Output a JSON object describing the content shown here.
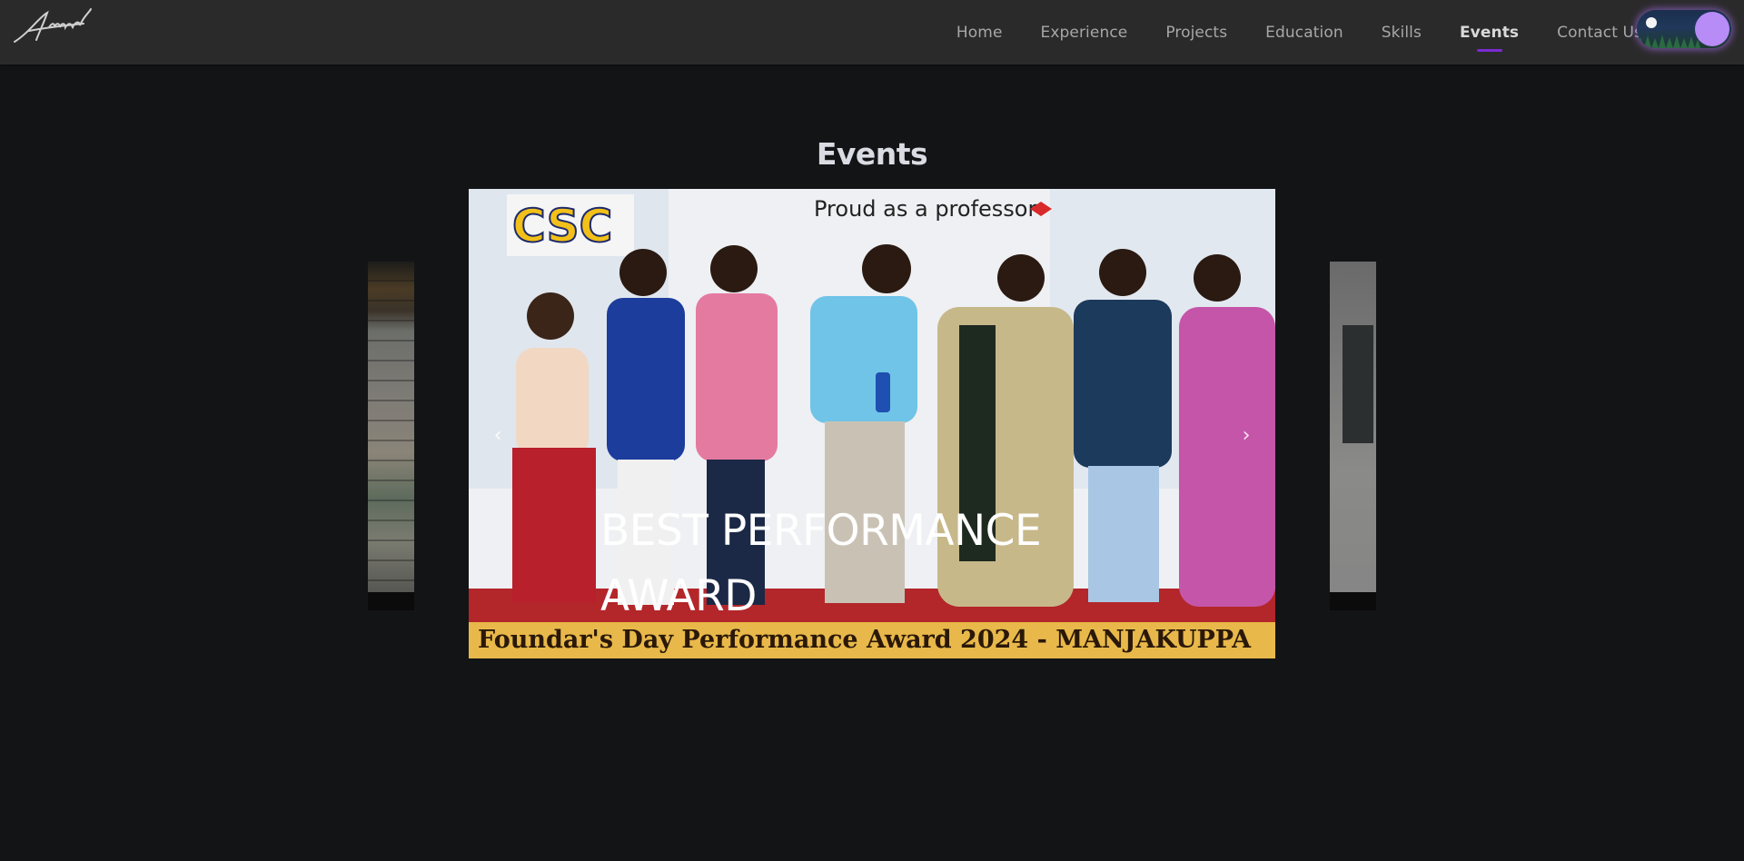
{
  "navbar": {
    "logo_text": "Anand",
    "links": [
      {
        "label": "Home",
        "active": false
      },
      {
        "label": "Experience",
        "active": false
      },
      {
        "label": "Projects",
        "active": false
      },
      {
        "label": "Education",
        "active": false
      },
      {
        "label": "Skills",
        "active": false
      },
      {
        "label": "Events",
        "active": true
      },
      {
        "label": "Contact Us",
        "active": false
      }
    ],
    "active_underline_color": "#7b2bd1",
    "toggle_knob_color": "#b78cf7",
    "theme_toggle_icon": "moon-night-toggle-icon"
  },
  "section": {
    "title": "Events"
  },
  "carousel": {
    "active_slide": {
      "caption": "BEST PERFORMANCE AWARD",
      "photo_top_text": "Proud as a professor",
      "photo_logo_text": "CSC",
      "photo_banner_text": "Foundar's Day Performance Award 2024 - MANJAKUPPA"
    },
    "prev_icon": "chevron-left-icon",
    "next_icon": "chevron-right-icon"
  }
}
